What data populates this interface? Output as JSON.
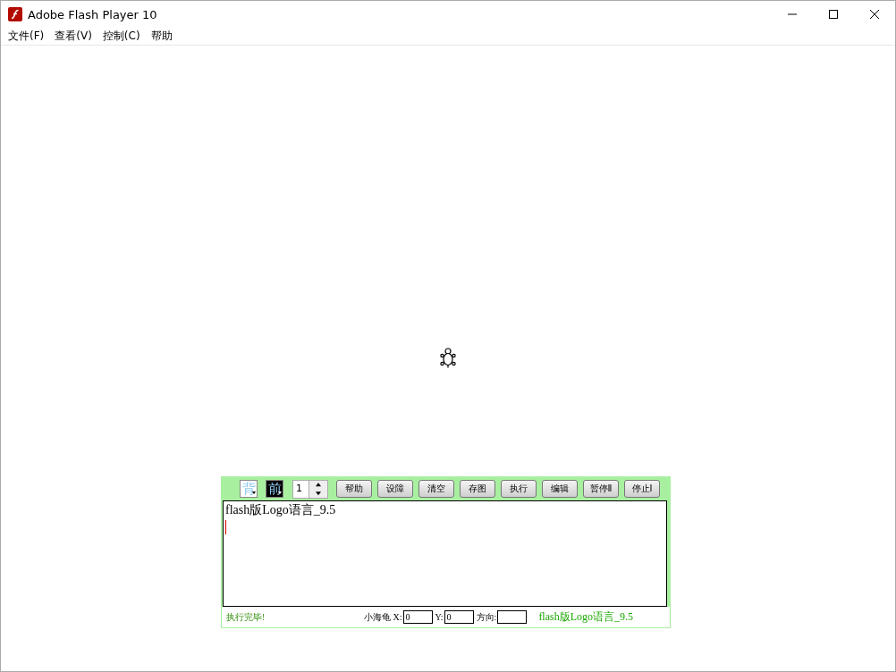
{
  "window": {
    "title": "Adobe Flash Player 10"
  },
  "menu": [
    "文件(F)",
    "查看(V)",
    "控制(C)",
    "帮助"
  ],
  "toolbar": {
    "color_buttons": [
      {
        "label": "背",
        "kind": "background"
      },
      {
        "label": "前",
        "kind": "foreground"
      }
    ],
    "spinner": {
      "value": "1"
    },
    "buttons": [
      "帮助",
      "设障",
      "清空",
      "存图",
      "执行",
      "编辑",
      "暂停Ⅱ",
      "停止Ⅰ"
    ]
  },
  "editor": {
    "value": "flash版Logo语言_9.5"
  },
  "status_bar": {
    "message": "执行完毕!",
    "x_label": "小海龟 X:",
    "x_value": "0",
    "y_label": "Y:",
    "y_value": "0",
    "heading_label": "方向:",
    "version": "flash版Logo语言_9.5"
  }
}
